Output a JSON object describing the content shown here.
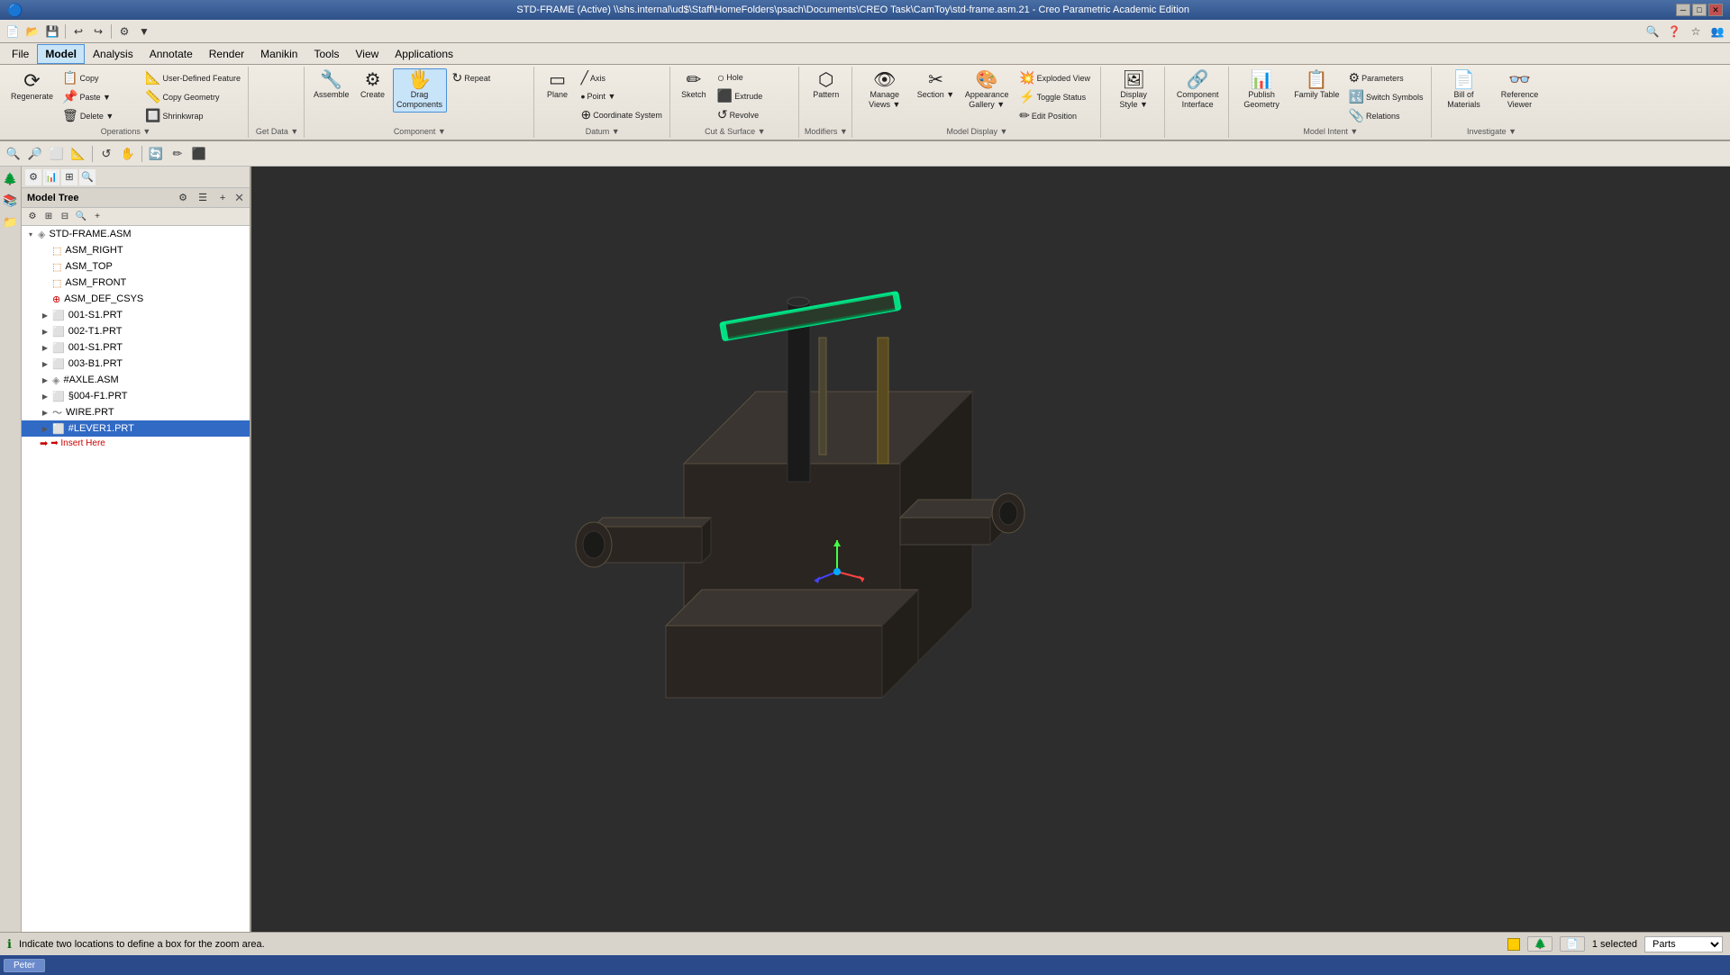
{
  "titlebar": {
    "title": "STD-FRAME (Active) \\\\shs.internal\\ud$\\Staff\\HomeFolders\\psach\\Documents\\CREO Task\\CamToy\\std-frame.asm.21 - Creo Parametric Academic Edition",
    "minimize": "─",
    "maximize": "□",
    "close": "✕"
  },
  "quickaccess": {
    "buttons": [
      "💾",
      "📁",
      "↩",
      "↪"
    ]
  },
  "menubar": {
    "items": [
      "File",
      "Model",
      "Analysis",
      "Annotate",
      "Render",
      "Manikin",
      "Tools",
      "View",
      "Applications"
    ]
  },
  "ribbon": {
    "tabs": [
      "Model",
      "Analysis",
      "Annotate",
      "Render",
      "Manikin",
      "Tools",
      "View",
      "Applications"
    ],
    "active_tab": "Model",
    "groups": [
      {
        "id": "operations",
        "label": "Operations ▼",
        "items": [
          {
            "icon": "⟳",
            "label": "Regenerate",
            "type": "large"
          },
          {
            "small_items": [
              {
                "icon": "📋",
                "label": "Copy"
              },
              {
                "icon": "📌",
                "label": "Paste ▼"
              },
              {
                "icon": "🗑",
                "label": "Delete ▼"
              }
            ]
          },
          {
            "small_items": [
              {
                "icon": "📐",
                "label": "User-Defined Feature"
              },
              {
                "icon": "📏",
                "label": "Copy Geometry"
              },
              {
                "icon": "🔲",
                "label": "Shrinkwrap"
              }
            ]
          }
        ]
      },
      {
        "id": "get-data",
        "label": "Get Data ▼",
        "items": []
      },
      {
        "id": "component",
        "label": "Component ▼",
        "items": [
          {
            "icon": "🔧",
            "label": "Assemble",
            "type": "large"
          },
          {
            "icon": "⚙",
            "label": "Create",
            "type": "large"
          },
          {
            "icon": "🖐",
            "label": "Drag\nComponents",
            "type": "large"
          },
          {
            "small_items": [
              {
                "icon": "↻",
                "label": "Repeat"
              }
            ]
          }
        ]
      },
      {
        "id": "datum",
        "label": "Datum ▼",
        "items": [
          {
            "icon": "▭",
            "label": "Plane",
            "type": "large"
          },
          {
            "small_items": [
              {
                "icon": "╱",
                "label": "Axis"
              },
              {
                "icon": "•",
                "label": "Point ▼"
              },
              {
                "icon": "⊕",
                "label": "Coordinate System"
              }
            ]
          }
        ]
      },
      {
        "id": "cut-surface",
        "label": "Cut & Surface ▼",
        "items": [
          {
            "icon": "✏",
            "label": "Sketch",
            "type": "large"
          },
          {
            "small_items": [
              {
                "icon": "○",
                "label": "Hole"
              },
              {
                "icon": "⬛",
                "label": "Extrude"
              },
              {
                "icon": "↺",
                "label": "Revolve"
              }
            ]
          }
        ]
      },
      {
        "id": "modifiers",
        "label": "Modifiers ▼",
        "items": [
          {
            "icon": "⬡",
            "label": "Pattern",
            "type": "large"
          }
        ]
      },
      {
        "id": "model-display",
        "label": "Model Display ▼",
        "items": [
          {
            "icon": "👁",
            "label": "Manage\nViews ▼",
            "type": "large"
          },
          {
            "icon": "✂",
            "label": "Section ▼",
            "type": "large"
          },
          {
            "icon": "🎨",
            "label": "Appearance\nGallery ▼",
            "type": "large"
          },
          {
            "small_items": [
              {
                "icon": "💥",
                "label": "Exploded View"
              },
              {
                "icon": "⚡",
                "label": "Toggle Status"
              },
              {
                "icon": "✏",
                "label": "Edit Position"
              }
            ]
          }
        ]
      },
      {
        "id": "display-style",
        "label": "",
        "items": [
          {
            "icon": "🖼",
            "label": "Display\nStyle ▼",
            "type": "large"
          }
        ]
      },
      {
        "id": "component-interface",
        "label": "",
        "items": [
          {
            "icon": "🔗",
            "label": "Component\nInterface",
            "type": "large"
          }
        ]
      },
      {
        "id": "model-intent",
        "label": "Model Intent ▼",
        "items": [
          {
            "icon": "📊",
            "label": "Publish\nGeometry",
            "type": "large"
          },
          {
            "icon": "📋",
            "label": "Family\nTable",
            "type": "large"
          },
          {
            "small_items": [
              {
                "icon": "⚙",
                "label": "Parameters"
              },
              {
                "icon": "🔣",
                "label": "Switch Symbols"
              },
              {
                "icon": "📎",
                "label": "Relations"
              }
            ]
          }
        ]
      },
      {
        "id": "investigate",
        "label": "Investigate ▼",
        "items": [
          {
            "icon": "📄",
            "label": "Bill of\nMaterials",
            "type": "large"
          },
          {
            "icon": "👓",
            "label": "Reference\nViewer",
            "type": "large"
          }
        ]
      }
    ]
  },
  "modeldisplay_toolbar": {
    "buttons": [
      "🔍",
      "🔍",
      "📐",
      "⬜",
      "🔲",
      "○",
      "✏",
      "✂",
      "⊕",
      "⚡"
    ]
  },
  "sidebar": {
    "title": "Model Tree",
    "tree_items": [
      {
        "id": "std-frame-asm",
        "label": "STD-FRAME.ASM",
        "icon": "asm",
        "indent": 0,
        "expanded": true
      },
      {
        "id": "asm-right",
        "label": "ASM_RIGHT",
        "icon": "plane",
        "indent": 1
      },
      {
        "id": "asm-top",
        "label": "ASM_TOP",
        "icon": "plane",
        "indent": 1
      },
      {
        "id": "asm-front",
        "label": "ASM_FRONT",
        "icon": "plane",
        "indent": 1
      },
      {
        "id": "asm-def-csys",
        "label": "ASM_DEF_CSYS",
        "icon": "coord",
        "indent": 1
      },
      {
        "id": "001-s1-prt-1",
        "label": "001-S1.PRT",
        "icon": "part",
        "indent": 1,
        "expandable": true
      },
      {
        "id": "002-t1-prt",
        "label": "002-T1.PRT",
        "icon": "part",
        "indent": 1,
        "expandable": true
      },
      {
        "id": "001-s1-prt-2",
        "label": "001-S1.PRT",
        "icon": "part",
        "indent": 1,
        "expandable": true
      },
      {
        "id": "003-b1-prt",
        "label": "003-B1.PRT",
        "icon": "part",
        "indent": 1,
        "expandable": true
      },
      {
        "id": "axle-asm",
        "label": "#AXLE.ASM",
        "icon": "asm",
        "indent": 1,
        "expandable": true
      },
      {
        "id": "004-f1-prt",
        "label": "§004-F1.PRT",
        "icon": "part",
        "indent": 1,
        "expandable": true
      },
      {
        "id": "wire-prt",
        "label": "WIRE.PRT",
        "icon": "wire",
        "indent": 1,
        "expandable": true
      },
      {
        "id": "lever1-prt",
        "label": "#LEVER1.PRT",
        "icon": "part",
        "indent": 1,
        "expandable": true,
        "selected": true
      }
    ],
    "insert_here": "➡ Insert Here"
  },
  "viewport": {
    "bg_color": "#2a2a2a"
  },
  "statusbar": {
    "icon": "ℹ",
    "message": "Indicate two locations to define a box for the zoom area.",
    "selected_count": "1 selected",
    "filter": "Parts"
  },
  "taskbar": {
    "items": [
      "Peter"
    ]
  },
  "colors": {
    "accent_blue": "#4a90d9",
    "selected_blue": "#316ac5",
    "title_gradient_start": "#4a6fa5",
    "title_gradient_end": "#2d5089",
    "body_bg": "#d4d0c8",
    "ribbon_bg": "#f0ece4",
    "model_dark": "#2d2d2d",
    "model_medium": "#3d3530",
    "highlight_green": "#00ff88"
  }
}
